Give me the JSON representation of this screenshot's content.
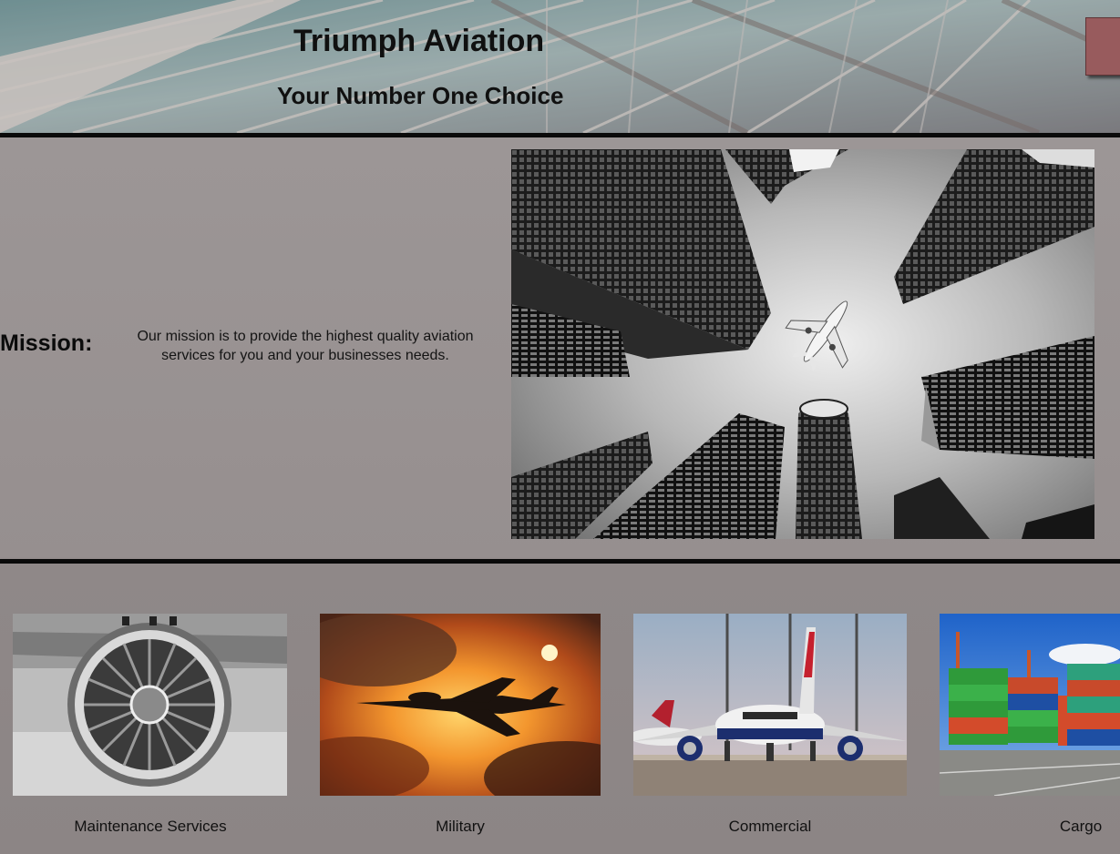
{
  "header": {
    "title": "Triumph Aviation",
    "subtitle": "Your Number One Choice",
    "menu_icon": "menu-icon"
  },
  "mission": {
    "label": "Mission:",
    "text": "Our mission is to provide the highest quality aviation services for you and your businesses needs.",
    "image_icon": "airplane-over-skyscrapers-photo"
  },
  "services": [
    {
      "label": "Maintenance Services",
      "image_icon": "jet-engine-photo"
    },
    {
      "label": "Military",
      "image_icon": "fighter-jet-sunset-photo"
    },
    {
      "label": "Commercial",
      "image_icon": "commercial-airliner-photo"
    },
    {
      "label": "Cargo",
      "image_icon": "shipping-containers-photo"
    }
  ],
  "colors": {
    "page_background": "#938c8c",
    "divider": "#0a0a0a",
    "menu_button": "#985b5d"
  }
}
